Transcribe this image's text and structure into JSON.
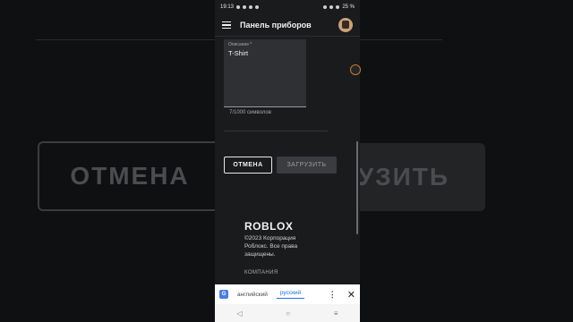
{
  "background": {
    "cancel_big": "ОТМЕНА",
    "upload_big": "УЗИТЬ"
  },
  "statusbar": {
    "time": "19:13",
    "battery": "25 %"
  },
  "appbar": {
    "title": "Панель приборов"
  },
  "form": {
    "description_label": "Описание *",
    "description_value": "T-Shirt",
    "counter": "7/1000 символов"
  },
  "actions": {
    "cancel": "ОТМЕНА",
    "upload": "ЗАГРУЗИТЬ"
  },
  "footer": {
    "logo": "ROBLOX",
    "copyright": "©2023 Корпорация Роблокс. Все права защищены.",
    "company": "КОМПАНИЯ"
  },
  "translate": {
    "lang_from": "английский",
    "lang_to": "русский",
    "menu_glyph": "⋮",
    "close_glyph": "✕"
  },
  "nav": {
    "back": "◁",
    "home": "○",
    "recents": "≡"
  },
  "colors": {
    "accent": "#1a73e8",
    "surface": "#191b1d"
  }
}
